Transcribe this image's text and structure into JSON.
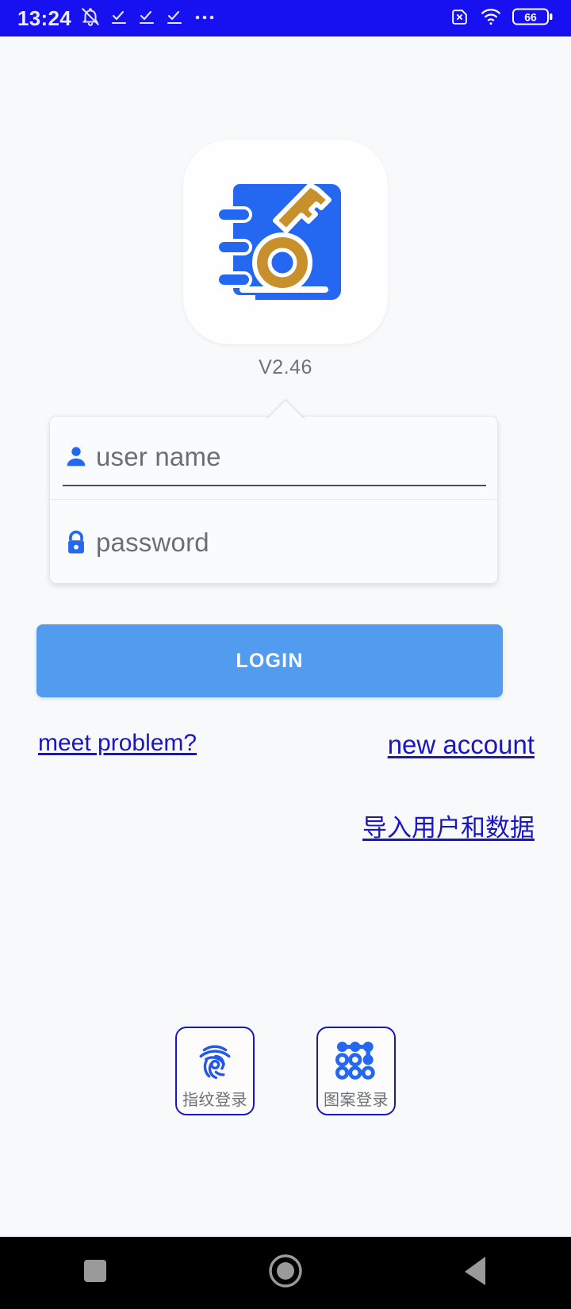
{
  "status_bar": {
    "time": "13:24",
    "background_color": "#1710f0",
    "left_icons": [
      {
        "name": "bell-muted-icon"
      },
      {
        "name": "task-check-icon"
      },
      {
        "name": "task-check-icon"
      },
      {
        "name": "task-check-icon"
      },
      {
        "name": "more-ellipsis-icon"
      }
    ],
    "right_icons": [
      {
        "name": "sim-card-off-icon"
      },
      {
        "name": "wifi-icon"
      }
    ],
    "battery_level": "66"
  },
  "app": {
    "logo_name": "notebook-key-app-icon",
    "version": "V2.46",
    "logo_colors": {
      "book": "#2468f2",
      "key": "#c8902c",
      "tile": "#fefefe"
    }
  },
  "form": {
    "username": {
      "icon": "person-icon",
      "placeholder": "user name",
      "value": ""
    },
    "password": {
      "icon": "lock-icon",
      "placeholder": "password",
      "value": ""
    }
  },
  "login_button": {
    "label": "LOGIN",
    "color": "#529cf0"
  },
  "links": {
    "meet_problem": "meet problem?",
    "new_account": "new account",
    "import_data": "导入用户和数据",
    "color": "#1a16c4"
  },
  "biometric": [
    {
      "icon": "fingerprint-icon",
      "label": "指纹登录"
    },
    {
      "icon": "pattern-lock-icon",
      "label": "图案登录"
    }
  ],
  "nav_bar": {
    "background_color": "#000000",
    "buttons": [
      {
        "name": "recents-button",
        "icon": "square-icon"
      },
      {
        "name": "home-button",
        "icon": "circle-icon"
      },
      {
        "name": "back-button",
        "icon": "triangle-left-icon"
      }
    ]
  }
}
